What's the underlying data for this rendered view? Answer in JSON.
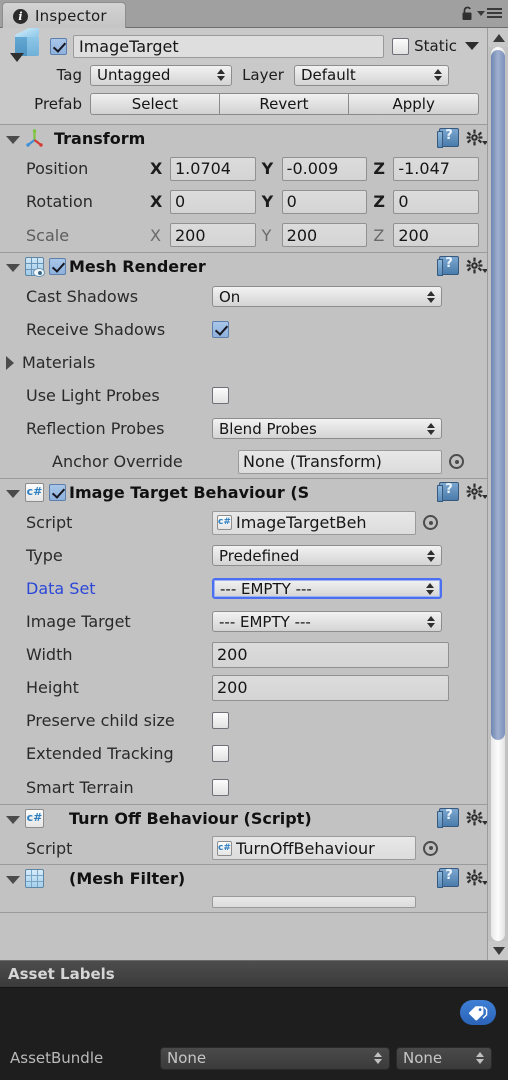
{
  "window": {
    "tab_label": "Inspector",
    "info_icon": "info-icon",
    "lock_icon": "lock-icon",
    "menu_icon": "hamburger-menu-icon"
  },
  "gameobject": {
    "enabled": true,
    "name": "ImageTarget",
    "static_label": "Static",
    "static_checked": false,
    "tag_label": "Tag",
    "tag_value": "Untagged",
    "layer_label": "Layer",
    "layer_value": "Default",
    "prefab_label": "Prefab",
    "prefab_buttons": [
      "Select",
      "Revert",
      "Apply"
    ]
  },
  "components": [
    {
      "title": "Transform",
      "icon": "transform-gizmo-icon",
      "has_checkbox": false,
      "rows": [
        {
          "label": "Position",
          "dim": false,
          "axes": [
            {
              "axis": "X",
              "value": "1.0704"
            },
            {
              "axis": "Y",
              "value": "-0.009"
            },
            {
              "axis": "Z",
              "value": "-1.047"
            }
          ]
        },
        {
          "label": "Rotation",
          "dim": false,
          "axes": [
            {
              "axis": "X",
              "value": "0"
            },
            {
              "axis": "Y",
              "value": "0"
            },
            {
              "axis": "Z",
              "value": "0"
            }
          ]
        },
        {
          "label": "Scale",
          "dim": true,
          "axes": [
            {
              "axis": "X",
              "value": "200"
            },
            {
              "axis": "Y",
              "value": "200"
            },
            {
              "axis": "Z",
              "value": "200"
            }
          ]
        }
      ]
    },
    {
      "title": "Mesh Renderer",
      "icon": "mesh-renderer-icon",
      "has_checkbox": true,
      "checked": true,
      "properties": [
        {
          "label": "Cast Shadows",
          "type": "popup",
          "value": "On"
        },
        {
          "label": "Receive Shadows",
          "type": "checkbox",
          "checked": true
        },
        {
          "label": "Materials",
          "type": "foldout"
        },
        {
          "label": "Use Light Probes",
          "type": "checkbox",
          "checked": false
        },
        {
          "label": "Reflection Probes",
          "type": "popup",
          "value": "Blend Probes"
        },
        {
          "label": "Anchor Override",
          "type": "objectfield",
          "value": "None (Transform)",
          "indented": true
        }
      ]
    },
    {
      "title": "Image Target Behaviour (S",
      "icon": "csharp-script-icon",
      "has_checkbox": true,
      "checked": true,
      "properties": [
        {
          "label": "Script",
          "type": "scriptfield",
          "value": "ImageTargetBeh"
        },
        {
          "label": "Type",
          "type": "popup",
          "value": "Predefined"
        },
        {
          "label": "Data Set",
          "type": "popup",
          "value": "--- EMPTY ---",
          "focused": true,
          "label_blue": true
        },
        {
          "label": "Image Target",
          "type": "popup",
          "value": "--- EMPTY ---"
        },
        {
          "label": "Width",
          "type": "text",
          "value": "200"
        },
        {
          "label": "Height",
          "type": "text",
          "value": "200"
        },
        {
          "label": "Preserve child size",
          "type": "checkbox",
          "checked": false
        },
        {
          "label": "Extended Tracking",
          "type": "checkbox",
          "checked": false
        },
        {
          "label": "Smart Terrain",
          "type": "checkbox",
          "checked": false
        }
      ]
    },
    {
      "title": "Turn Off Behaviour (Script)",
      "icon": "csharp-script-icon",
      "has_checkbox": false,
      "properties": [
        {
          "label": "Script",
          "type": "scriptfield",
          "value": "TurnOffBehaviour"
        }
      ]
    },
    {
      "title": "(Mesh Filter)",
      "icon": "mesh-filter-icon",
      "has_checkbox": false,
      "properties": []
    }
  ],
  "footer": {
    "title": "Asset Labels",
    "tag_icon": "label-tag-icon",
    "assetbundle_label": "AssetBundle",
    "assetbundle_value": "None",
    "variant_value": "None"
  },
  "icons": {
    "help": "help-book-icon",
    "gear": "gear-settings-icon"
  },
  "colors": {
    "panel_bg": "#c2c2c2",
    "tabbar_bg": "#a0a0a0",
    "focus_blue": "#4a6ff0",
    "label_blue": "#2b47d8",
    "footer_bg": "#1e1e1e",
    "tag_blue": "#2b63b8"
  }
}
